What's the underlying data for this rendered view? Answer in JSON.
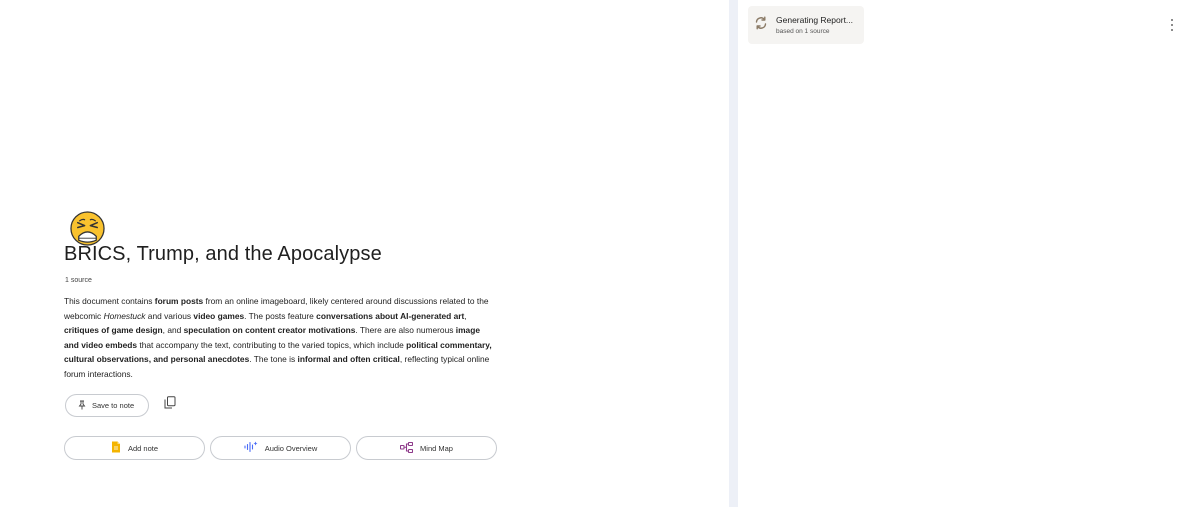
{
  "notebook": {
    "emoji": "😫",
    "title": "BRICS, Trump, and the Apocalypse",
    "source_count": "1 source",
    "summary": [
      {
        "t": "This document contains ",
        "s": "n"
      },
      {
        "t": "forum posts",
        "s": "b"
      },
      {
        "t": " from an online imageboard, likely centered around discussions related to the webcomic ",
        "s": "n"
      },
      {
        "t": "Homestuck",
        "s": "i"
      },
      {
        "t": " and various ",
        "s": "n"
      },
      {
        "t": "video games",
        "s": "b"
      },
      {
        "t": ". The posts feature ",
        "s": "n"
      },
      {
        "t": "conversations about AI-generated art",
        "s": "b"
      },
      {
        "t": ", ",
        "s": "n"
      },
      {
        "t": "critiques of game design",
        "s": "b"
      },
      {
        "t": ", and ",
        "s": "n"
      },
      {
        "t": "speculation on content creator motivations",
        "s": "b"
      },
      {
        "t": ". There are also numerous ",
        "s": "n"
      },
      {
        "t": "image and video embeds",
        "s": "b"
      },
      {
        "t": " that accompany the text, contributing to the varied topics, which include ",
        "s": "n"
      },
      {
        "t": "political commentary, cultural observations, and personal anecdotes",
        "s": "b"
      },
      {
        "t": ". The tone is ",
        "s": "n"
      },
      {
        "t": "informal and often critical",
        "s": "b"
      },
      {
        "t": ", reflecting typical online forum interactions.",
        "s": "n"
      }
    ]
  },
  "buttons": {
    "save_to_note": "Save to note",
    "add_note": "Add note",
    "audio_overview": "Audio Overview",
    "mind_map": "Mind Map"
  },
  "studio": {
    "generating_title": "Generating Report...",
    "generating_sub": "based on 1 source"
  },
  "icons": {
    "pin": "pin-icon",
    "copy": "copy-icon",
    "note": "note-icon",
    "audio": "audio-wave-icon",
    "mindmap": "mind-map-icon",
    "refresh": "sync-icon",
    "more": "more-vert-icon"
  },
  "colors": {
    "note_icon": "#f4b400",
    "audio_icon": "#4a6cf7",
    "mindmap_icon": "#8e3b8a",
    "divider": "#edf0f7",
    "card_bg": "#f5f4f2"
  }
}
